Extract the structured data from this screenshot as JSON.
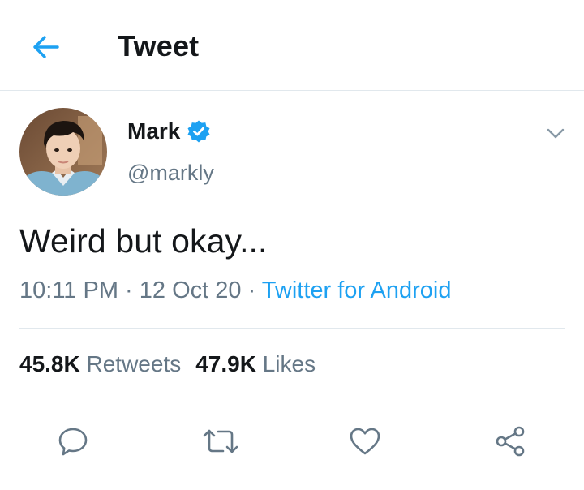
{
  "header": {
    "title": "Tweet",
    "back_icon": "arrow-left-icon"
  },
  "tweet": {
    "author": {
      "name": "Mark",
      "handle": "@markly",
      "verified": true
    },
    "text": "Weird but okay...",
    "time": "10:11 PM",
    "date": "12 Oct 20",
    "source": "Twitter for Android",
    "separator": " · "
  },
  "stats": {
    "retweets": {
      "count": "45.8K",
      "label": "Retweets"
    },
    "likes": {
      "count": "47.9K",
      "label": "Likes"
    }
  },
  "actions": [
    {
      "name": "reply",
      "icon": "reply-icon"
    },
    {
      "name": "retweet",
      "icon": "retweet-icon"
    },
    {
      "name": "like",
      "icon": "heart-icon"
    },
    {
      "name": "share",
      "icon": "share-icon"
    }
  ],
  "colors": {
    "accent": "#1da1f2",
    "text": "#14171a",
    "secondary": "#657786",
    "divider": "#e1e8ed"
  }
}
